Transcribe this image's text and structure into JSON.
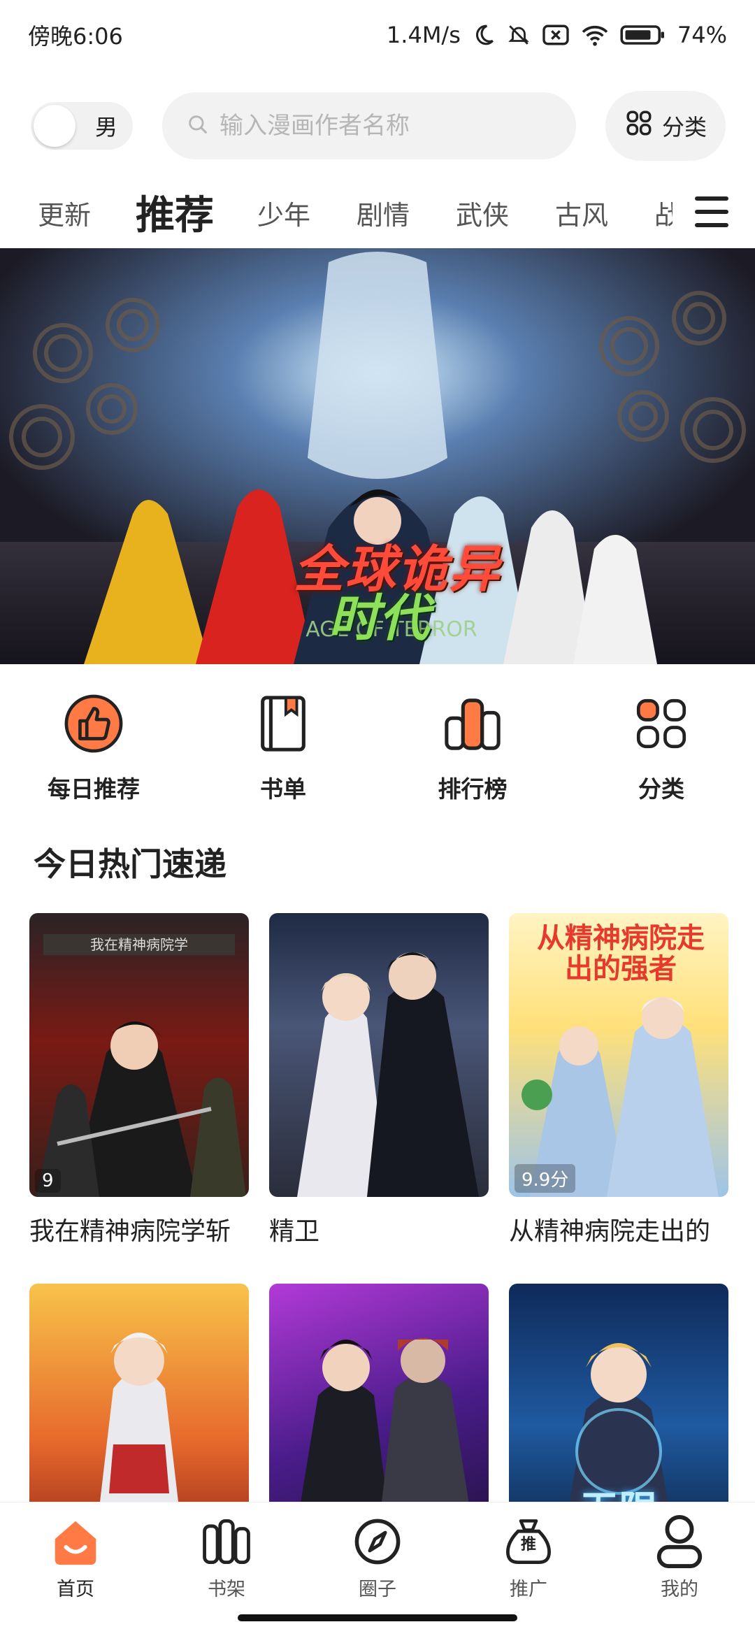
{
  "status": {
    "time": "傍晚6:06",
    "speed": "1.4M/s",
    "battery": "74%"
  },
  "search": {
    "gender": "男",
    "placeholder": "输入漫画作者名称",
    "category_label": "分类"
  },
  "tabs": [
    {
      "label": "更新",
      "active": false
    },
    {
      "label": "推荐",
      "active": true
    },
    {
      "label": "少年",
      "active": false
    },
    {
      "label": "剧情",
      "active": false
    },
    {
      "label": "武侠",
      "active": false
    },
    {
      "label": "古风",
      "active": false
    },
    {
      "label": "战",
      "active": false,
      "clipped": true
    }
  ],
  "banner": {
    "title_line1": "全球诡异",
    "title_line2": "时代",
    "subtitle": "AGE OF TERROR"
  },
  "shortcuts": [
    {
      "label": "每日推荐",
      "icon": "thumbs-up-icon"
    },
    {
      "label": "书单",
      "icon": "book-icon"
    },
    {
      "label": "排行榜",
      "icon": "ranking-icon"
    },
    {
      "label": "分类",
      "icon": "grid-icon"
    }
  ],
  "section": {
    "title": "今日热门速递"
  },
  "comics": [
    {
      "title": "我在精神病院学斩",
      "score": "9",
      "cover_text": "我在精神病院学"
    },
    {
      "title": "精卫",
      "score": "",
      "cover_text": ""
    },
    {
      "title": "从精神病院走出的",
      "score": "9.9分",
      "cover_text": "从精神病院走出的强者"
    },
    {
      "title": "",
      "score": "",
      "cover_text": ""
    },
    {
      "title": "",
      "score": "",
      "cover_text": ""
    },
    {
      "title": "",
      "score": "",
      "cover_text": "无限"
    }
  ],
  "nav": [
    {
      "label": "首页",
      "icon": "home-icon",
      "active": true
    },
    {
      "label": "书架",
      "icon": "bookshelf-icon",
      "active": false
    },
    {
      "label": "圈子",
      "icon": "compass-icon",
      "active": false
    },
    {
      "label": "推广",
      "icon": "promote-bag-icon",
      "active": false,
      "badge_text": "推"
    },
    {
      "label": "我的",
      "icon": "profile-icon",
      "active": false
    }
  ],
  "colors": {
    "accent": "#ff7a45",
    "accent_light": "#ff9a5c",
    "text": "#222222",
    "muted": "#b6b6b6"
  }
}
